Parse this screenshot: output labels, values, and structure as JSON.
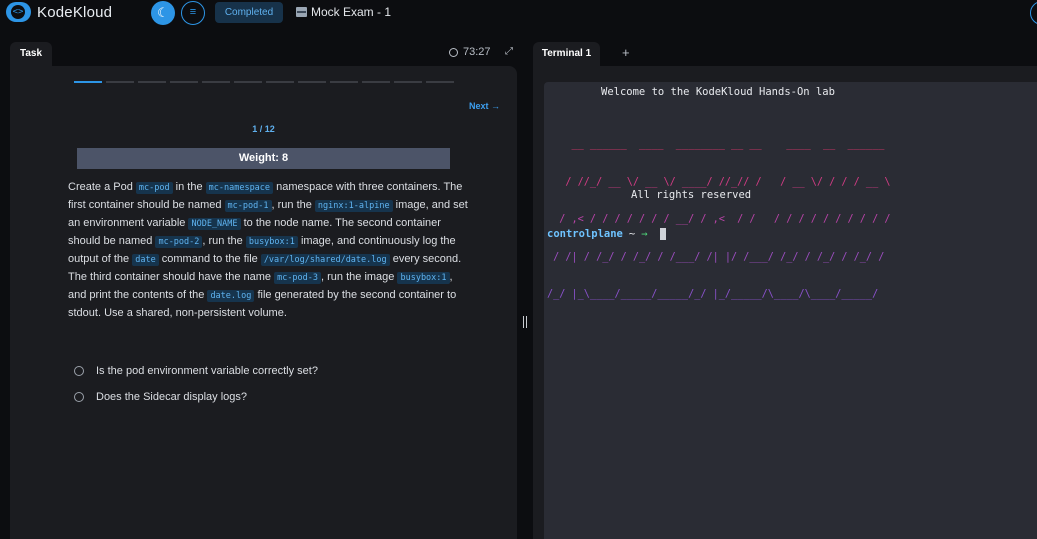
{
  "header": {
    "logo_text": "KodeKloud",
    "theme_icon": "☾",
    "menu_icon": "≡",
    "status": "Completed",
    "exam_title": "Mock Exam - 1"
  },
  "task_panel": {
    "tab_label": "Task",
    "timer": "73:27",
    "expand_icon": "⤢",
    "progress": {
      "current": 1,
      "total": 12
    },
    "next_label": "Next →",
    "counter": "1 / 12",
    "weight": "Weight: 8",
    "text": {
      "t1": "Create a Pod ",
      "c1": "mc-pod",
      "t2": " in the ",
      "c2": "mc-namespace",
      "t3": " namespace with three containers. The first container should be named ",
      "c3": "mc-pod-1",
      "t4": ", run the ",
      "c4": "nginx:1-alpine",
      "t5": " image, and set an environment variable ",
      "c5": "NODE_NAME",
      "t6": " to the node name. The second container should be named ",
      "c6": "mc-pod-2",
      "t7": ", run the ",
      "c7": "busybox:1",
      "t8": " image, and continuously log the output of the ",
      "c8": "date",
      "t9": " command to the file ",
      "c9": "/var/log/shared/date.log",
      "t10": " every second. The third container should have the name ",
      "c10": "mc-pod-3",
      "t11": ", run the image ",
      "c11": "busybox:1",
      "t12": ", and print the contents of the ",
      "c12": "date.log",
      "t13": " file generated by the second container to stdout. Use a shared, non-persistent volume."
    },
    "checks": [
      {
        "label": "Is the pod environment variable correctly set?"
      },
      {
        "label": "Does the Sidecar display logs?"
      }
    ]
  },
  "terminal": {
    "tab_label": "Terminal 1",
    "add_tab": "+",
    "welcome": "Welcome to the KodeKloud Hands-On lab",
    "ascii_art": [
      "    __ ______  ____  ________ __ __    ____  __  ______",
      "   / //_/ __ \\/ __ \\/ ____/ //_// /   / __ \\/ / / / __ \\",
      "  / ,< / / / / / / / __/ / ,<  / /   / / / / / / / / / /",
      " / /| / /_/ / /_/ / /___/ /| |/ /___/ /_/ / /_/ / /_/ /",
      "/_/ |_\\____/_____/_____/_/ |_/_____/\\____/\\____/_____/"
    ],
    "rights": "All rights reserved",
    "prompt_host": "controlplane",
    "prompt_path": "~",
    "prompt_arrow": "→"
  }
}
